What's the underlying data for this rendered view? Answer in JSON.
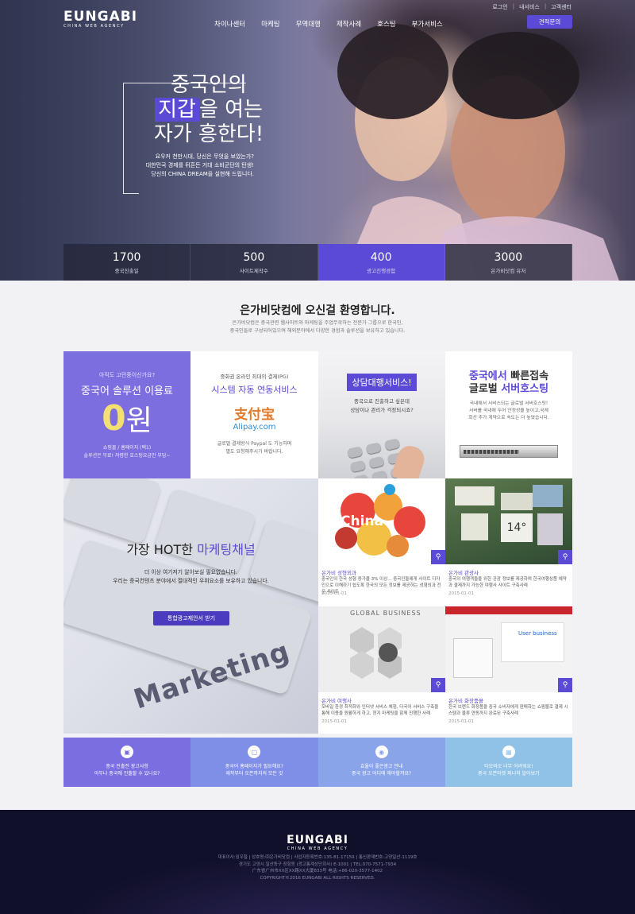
{
  "topbar": {
    "links": [
      "로그인",
      "내서비스",
      "고객센터"
    ]
  },
  "logo": {
    "main": "EUNGABI",
    "sub": "CHINA WEB AGENCY"
  },
  "nav": {
    "items": [
      "차이나센터",
      "마케팅",
      "무역대행",
      "제작사례",
      "호스팅",
      "부가서비스"
    ],
    "quote_button": "견적문의"
  },
  "hero": {
    "line1": "중국인의",
    "line2_box": "지갑",
    "line2_rest": "을 여는",
    "line3": "자가 흥한다!",
    "sub": [
      "요우커 천만시대, 당신은 무엇을 보았는가?",
      "대한민국 경제를 뒤흔든 거대 소비군단의 탄생!",
      "당신의 CHINA DREAM을 실현해 드립니다."
    ]
  },
  "stats": [
    {
      "num": "1700",
      "label": "중국진출일"
    },
    {
      "num": "500",
      "label": "사이트제작수"
    },
    {
      "num": "400",
      "label": "광고진행경험"
    },
    {
      "num": "3000",
      "label": "은가비닷컴 유저"
    }
  ],
  "welcome": {
    "title": "은가비닷컴에 오신걸 환영합니다.",
    "sub": [
      "은가비닷컴은 중국관련 웹사이트와 마케팅을 주업무로하는 전문가 그룹으로 한국인,",
      "중국인들로 구성되어있으며 해외분야에서 다양한 경험과 솔루션을 보유하고 있습니다."
    ]
  },
  "tile1": {
    "question": "아직도 고민중이신가요?",
    "headline": "중국어 솔루션 이용료",
    "zero": "0",
    "won": "원",
    "sub": [
      "쇼핑몰 / 홈페이지 (택1)",
      "솔루션은 무료! 저렴한 호스팅요금만 부담~"
    ]
  },
  "tile2": {
    "question": "중화권 온라인 최대의 결제(PG)",
    "headline": "시스템 자동 연동서비스",
    "alipay_cn": "支付宝",
    "alipay_en": "Alipay.com",
    "sub": [
      "글로벌 결제방식 Paypal 도 기능하며",
      "별도 요청해주시기 바랍니다."
    ]
  },
  "tile3": {
    "headline": "상담대행서비스!",
    "sub": [
      "중국으로 진출하고 싶은데",
      "상담이나 관리가 걱정되시죠?"
    ]
  },
  "tile4": {
    "h1a": "중국에서",
    "h1b": "빠른접속",
    "h2a": "글로벌",
    "h2b": "서버호스팅",
    "sub": [
      "국내에서 서비스되는 글로벌 서버호스팅!",
      "서버를 국내에 두어 안정성을 높이고,국제",
      "회선 추가 계약으로 속도는 더 높였습니다."
    ]
  },
  "marketing": {
    "head_plain": "가장 HOT한",
    "head_color": "마케팅채널",
    "sub": [
      "더 이상 여기저기 알아보실 필요없습니다.",
      "우리는 중국컨텐츠 분야에서 절대적인 우위요소를 보유하고 있습니다."
    ],
    "button": "통합광고제안서 받기",
    "keyboard_word": "Marketing"
  },
  "cards": [
    {
      "title": "은가비 성형외과",
      "desc": "중국인의 한국 성형 증가율 3% 이상... 중국인들에게 사이트 디자인으로 이해하기 쉽도록 한국의 모든 정보를 제공하는 성형외과 전문 사이트",
      "date": "2015-01-01",
      "img_label": "China"
    },
    {
      "title": "은가비 관광사",
      "desc": "중국의 여행객들을 위한 관광 정보를 제공하며 한국여행상품 예약과 결제까지 가능한 여행사 사이트 구축사례",
      "date": "2015-01-01",
      "img_label": "14°"
    },
    {
      "title": "은가비 여행사",
      "desc": "모바일 환경 최적화와 인터넷 서비스 체험, 다국어 서비스 구축을 통해 이용을 원활하게 하고, 현지 마케팅을 함께 진행한 사례",
      "date": "2015-01-01",
      "img_label": "GLOBAL BUSINESS"
    },
    {
      "title": "은가비 화장품몰",
      "desc": "한국 브랜드 화장품을 중국 소비자에게 판매하는 쇼핑몰로 결제 시스템과 물류 연동까지 완료된 구축사례",
      "date": "2015-01-01",
      "img_label": "User business"
    }
  ],
  "bottom": [
    {
      "icon": "building-icon",
      "text": [
        "중국 진출전 광고사항",
        "아무나 중국에 진출할 수 있나요?"
      ],
      "color": "#7a6ee0"
    },
    {
      "icon": "monitor-icon",
      "text": [
        "중국어 홈페이지가 필요해요?",
        "제작부터 오픈까지의 모든 것"
      ],
      "color": "#7f8ee6"
    },
    {
      "icon": "globe-icon",
      "text": [
        "효율이 좋은광고 안내",
        "중국 광고 어디에 해야할까요?"
      ],
      "color": "#8aa4ea"
    },
    {
      "icon": "calendar-icon",
      "text": [
        "타오바오 너무 어려워요!",
        "중국 오픈마켓 파니칙 알아보기"
      ],
      "color": "#8fc2e6"
    }
  ],
  "footer": {
    "logo_main": "EUNGABI",
    "logo_sub": "CHINA WEB AGENCY",
    "lines": [
      "대표이사:임우철 | 상호명:㈜은가비닷컴 | 사업자등록번호:135-81-17159 | 통신판매번호:고양일산-1119호",
      "경기도 고양시 일산동구 장항동 (광고통계상단회사) E-1001 | TEL:070-7571-7934",
      "广东省广州市XX区XX路XX大厦833号 电话:+86-020-3577-1402",
      "COPYRIGHT©2016 EUNGABI ALL RIGHTS RESERVED."
    ]
  },
  "colors": {
    "accent": "#5b4ad6",
    "footer_bg": "#11102a"
  }
}
